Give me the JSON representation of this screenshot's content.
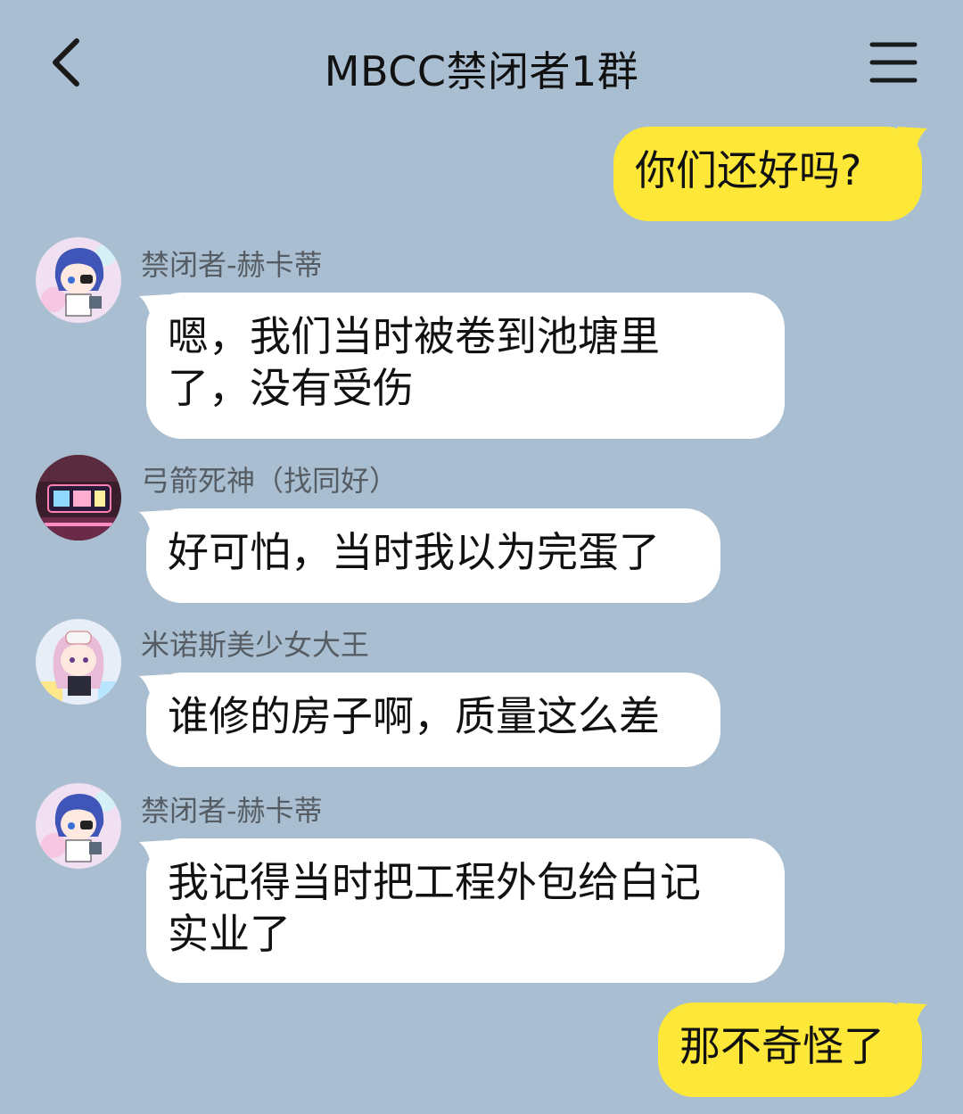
{
  "header": {
    "title": "MBCC禁闭者1群",
    "back_icon": "chevron-left-icon",
    "menu_icon": "hamburger-menu-icon"
  },
  "colors": {
    "background": "#a9bfd1",
    "outgoing_bubble": "#fde738",
    "incoming_bubble": "#ffffff"
  },
  "messages": [
    {
      "direction": "outgoing",
      "lines": [
        "你们还好吗?"
      ]
    },
    {
      "direction": "incoming",
      "sender": "禁闭者-赫卡蒂",
      "avatar": "hecate-avatar",
      "lines": [
        "嗯，我们当时被卷到池塘里",
        "了，没有受伤"
      ]
    },
    {
      "direction": "incoming",
      "sender": "弓箭死神（找同好）",
      "avatar": "neon-sign-avatar",
      "lines": [
        "好可怕，当时我以为完蛋了"
      ]
    },
    {
      "direction": "incoming",
      "sender": "米诺斯美少女大王",
      "avatar": "pink-hair-girl-avatar",
      "lines": [
        "谁修的房子啊，质量这么差"
      ]
    },
    {
      "direction": "incoming",
      "sender": "禁闭者-赫卡蒂",
      "avatar": "hecate-avatar",
      "lines": [
        "我记得当时把工程外包给白记",
        "实业了"
      ]
    },
    {
      "direction": "outgoing",
      "lines": [
        "那不奇怪了"
      ]
    }
  ]
}
